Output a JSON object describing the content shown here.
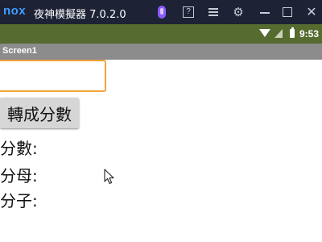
{
  "emulator": {
    "logo": "nox",
    "title": "夜神模擬器 7.0.2.0",
    "controls": [
      "mic-icon",
      "help-icon",
      "menu-icon",
      "gear-icon",
      "minimize-icon",
      "maximize-icon",
      "close-icon"
    ],
    "help_glyph": "?",
    "gear_glyph": "⚙",
    "close_glyph": "✕",
    "colors": {
      "bar": "#1e2235",
      "logo": "#3f9dff",
      "mic": "#8c5bff"
    }
  },
  "status_bar": {
    "time": "9:53",
    "icons": [
      "wifi-icon",
      "signal-icon",
      "battery-icon"
    ],
    "color": "#556b2f"
  },
  "screen": {
    "title": "Screen1",
    "title_bar_color": "#8c8c8c"
  },
  "form": {
    "input_value": "",
    "input_border_color": "#f3a33a",
    "convert_button": "轉成分數",
    "labels": {
      "score": "分數:",
      "denominator": "分母:",
      "numerator": "分子:"
    }
  }
}
